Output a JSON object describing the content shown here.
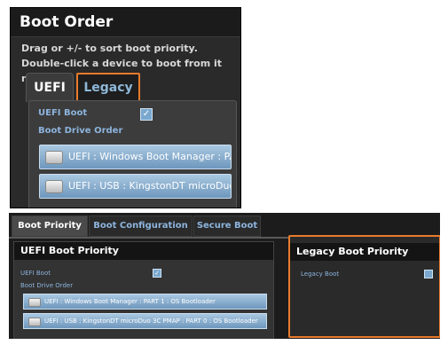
{
  "top": {
    "title": "Boot Order",
    "description": "Drag or +/- to sort boot priority. Double-click a device to boot from it now.",
    "tabs": [
      {
        "label": "UEFI",
        "selected": true
      },
      {
        "label": "Legacy",
        "selected": false
      }
    ],
    "uefi_boot_label": "UEFI Boot",
    "uefi_boot_checked": "✓",
    "boot_drive_order_label": "Boot Drive Order",
    "drives": [
      {
        "label": "UEFI : Windows Boot Manager : PAR",
        "icon": "disk-drive-icon"
      },
      {
        "label": "UEFI : USB : KingstonDT microDuo",
        "icon": "disk-drive-icon"
      }
    ]
  },
  "bottom": {
    "tabs": [
      {
        "label": "Boot Priority",
        "selected": true
      },
      {
        "label": "Boot Configuration",
        "selected": false
      },
      {
        "label": "Secure Boot",
        "selected": false
      }
    ],
    "uefi_panel": {
      "title": "UEFI Boot Priority",
      "uefi_boot_label": "UEFI Boot",
      "uefi_boot_checked": "✓",
      "boot_drive_order_label": "Boot Drive Order",
      "drives": [
        {
          "label": "UEFI : Windows Boot Manager : PART 1 : OS Bootloader"
        },
        {
          "label": "UEFI : USB : KingstonDT microDuo 3C PMAP : PART 0 : OS Bootloader"
        }
      ]
    },
    "legacy_panel": {
      "title": "Legacy Boot Priority",
      "legacy_boot_label": "Legacy Boot",
      "legacy_boot_checked": ""
    }
  },
  "colors": {
    "highlight": "#e87b2c",
    "label_blue": "#8db4dd",
    "drive_blue": "#7aa8cf"
  }
}
